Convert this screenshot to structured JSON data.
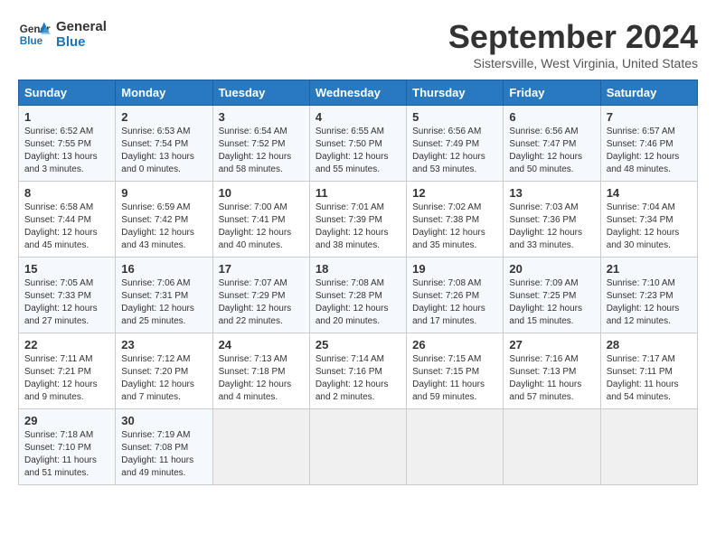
{
  "header": {
    "logo_line1": "General",
    "logo_line2": "Blue",
    "month": "September 2024",
    "location": "Sistersville, West Virginia, United States"
  },
  "weekdays": [
    "Sunday",
    "Monday",
    "Tuesday",
    "Wednesday",
    "Thursday",
    "Friday",
    "Saturday"
  ],
  "weeks": [
    [
      {
        "day": "1",
        "info": "Sunrise: 6:52 AM\nSunset: 7:55 PM\nDaylight: 13 hours\nand 3 minutes."
      },
      {
        "day": "2",
        "info": "Sunrise: 6:53 AM\nSunset: 7:54 PM\nDaylight: 13 hours\nand 0 minutes."
      },
      {
        "day": "3",
        "info": "Sunrise: 6:54 AM\nSunset: 7:52 PM\nDaylight: 12 hours\nand 58 minutes."
      },
      {
        "day": "4",
        "info": "Sunrise: 6:55 AM\nSunset: 7:50 PM\nDaylight: 12 hours\nand 55 minutes."
      },
      {
        "day": "5",
        "info": "Sunrise: 6:56 AM\nSunset: 7:49 PM\nDaylight: 12 hours\nand 53 minutes."
      },
      {
        "day": "6",
        "info": "Sunrise: 6:56 AM\nSunset: 7:47 PM\nDaylight: 12 hours\nand 50 minutes."
      },
      {
        "day": "7",
        "info": "Sunrise: 6:57 AM\nSunset: 7:46 PM\nDaylight: 12 hours\nand 48 minutes."
      }
    ],
    [
      {
        "day": "8",
        "info": "Sunrise: 6:58 AM\nSunset: 7:44 PM\nDaylight: 12 hours\nand 45 minutes."
      },
      {
        "day": "9",
        "info": "Sunrise: 6:59 AM\nSunset: 7:42 PM\nDaylight: 12 hours\nand 43 minutes."
      },
      {
        "day": "10",
        "info": "Sunrise: 7:00 AM\nSunset: 7:41 PM\nDaylight: 12 hours\nand 40 minutes."
      },
      {
        "day": "11",
        "info": "Sunrise: 7:01 AM\nSunset: 7:39 PM\nDaylight: 12 hours\nand 38 minutes."
      },
      {
        "day": "12",
        "info": "Sunrise: 7:02 AM\nSunset: 7:38 PM\nDaylight: 12 hours\nand 35 minutes."
      },
      {
        "day": "13",
        "info": "Sunrise: 7:03 AM\nSunset: 7:36 PM\nDaylight: 12 hours\nand 33 minutes."
      },
      {
        "day": "14",
        "info": "Sunrise: 7:04 AM\nSunset: 7:34 PM\nDaylight: 12 hours\nand 30 minutes."
      }
    ],
    [
      {
        "day": "15",
        "info": "Sunrise: 7:05 AM\nSunset: 7:33 PM\nDaylight: 12 hours\nand 27 minutes."
      },
      {
        "day": "16",
        "info": "Sunrise: 7:06 AM\nSunset: 7:31 PM\nDaylight: 12 hours\nand 25 minutes."
      },
      {
        "day": "17",
        "info": "Sunrise: 7:07 AM\nSunset: 7:29 PM\nDaylight: 12 hours\nand 22 minutes."
      },
      {
        "day": "18",
        "info": "Sunrise: 7:08 AM\nSunset: 7:28 PM\nDaylight: 12 hours\nand 20 minutes."
      },
      {
        "day": "19",
        "info": "Sunrise: 7:08 AM\nSunset: 7:26 PM\nDaylight: 12 hours\nand 17 minutes."
      },
      {
        "day": "20",
        "info": "Sunrise: 7:09 AM\nSunset: 7:25 PM\nDaylight: 12 hours\nand 15 minutes."
      },
      {
        "day": "21",
        "info": "Sunrise: 7:10 AM\nSunset: 7:23 PM\nDaylight: 12 hours\nand 12 minutes."
      }
    ],
    [
      {
        "day": "22",
        "info": "Sunrise: 7:11 AM\nSunset: 7:21 PM\nDaylight: 12 hours\nand 9 minutes."
      },
      {
        "day": "23",
        "info": "Sunrise: 7:12 AM\nSunset: 7:20 PM\nDaylight: 12 hours\nand 7 minutes."
      },
      {
        "day": "24",
        "info": "Sunrise: 7:13 AM\nSunset: 7:18 PM\nDaylight: 12 hours\nand 4 minutes."
      },
      {
        "day": "25",
        "info": "Sunrise: 7:14 AM\nSunset: 7:16 PM\nDaylight: 12 hours\nand 2 minutes."
      },
      {
        "day": "26",
        "info": "Sunrise: 7:15 AM\nSunset: 7:15 PM\nDaylight: 11 hours\nand 59 minutes."
      },
      {
        "day": "27",
        "info": "Sunrise: 7:16 AM\nSunset: 7:13 PM\nDaylight: 11 hours\nand 57 minutes."
      },
      {
        "day": "28",
        "info": "Sunrise: 7:17 AM\nSunset: 7:11 PM\nDaylight: 11 hours\nand 54 minutes."
      }
    ],
    [
      {
        "day": "29",
        "info": "Sunrise: 7:18 AM\nSunset: 7:10 PM\nDaylight: 11 hours\nand 51 minutes."
      },
      {
        "day": "30",
        "info": "Sunrise: 7:19 AM\nSunset: 7:08 PM\nDaylight: 11 hours\nand 49 minutes."
      },
      {
        "day": "",
        "info": ""
      },
      {
        "day": "",
        "info": ""
      },
      {
        "day": "",
        "info": ""
      },
      {
        "day": "",
        "info": ""
      },
      {
        "day": "",
        "info": ""
      }
    ]
  ]
}
